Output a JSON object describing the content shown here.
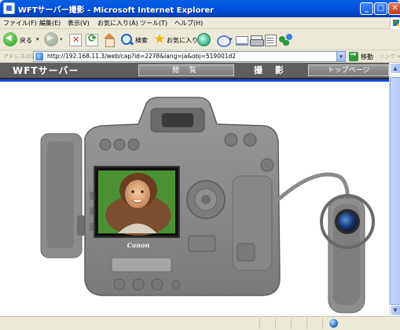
{
  "window": {
    "title": "WFTサーバー撮影 - Microsoft Internet Explorer",
    "controls": {
      "minimize": "_",
      "maximize": "□",
      "close": "✕"
    }
  },
  "menu": [
    "ファイル(F)",
    "編集(E)",
    "表示(V)",
    "お気に入り(A)",
    "ツール(T)",
    "ヘルプ(H)"
  ],
  "toolbar": {
    "back_label": "戻る",
    "search_label": "検索",
    "favorites_label": "お気に入り",
    "dropdown_glyph": "▾"
  },
  "address": {
    "label": "アドレス(D)",
    "url": "http://192.168.11.3/web/cap?id=2278&lang=ja&obj=519001d2",
    "go_label": "移動",
    "links_label": "リンク »"
  },
  "page": {
    "brand": "WFTサーバー",
    "tabs": [
      {
        "label": "閲 覧",
        "active": false
      },
      {
        "label": "撮 影",
        "active": true
      },
      {
        "label": "トップページ",
        "active": false
      }
    ],
    "camera_brand": "Canon"
  },
  "scrollbar": {
    "up": "▲",
    "down": "▼"
  },
  "colors": {
    "titlebar": "#0055e5",
    "navbar": "#5e5e5e",
    "accent_rule": "#1a4ad8",
    "camera_body": "#8a8a8a"
  }
}
